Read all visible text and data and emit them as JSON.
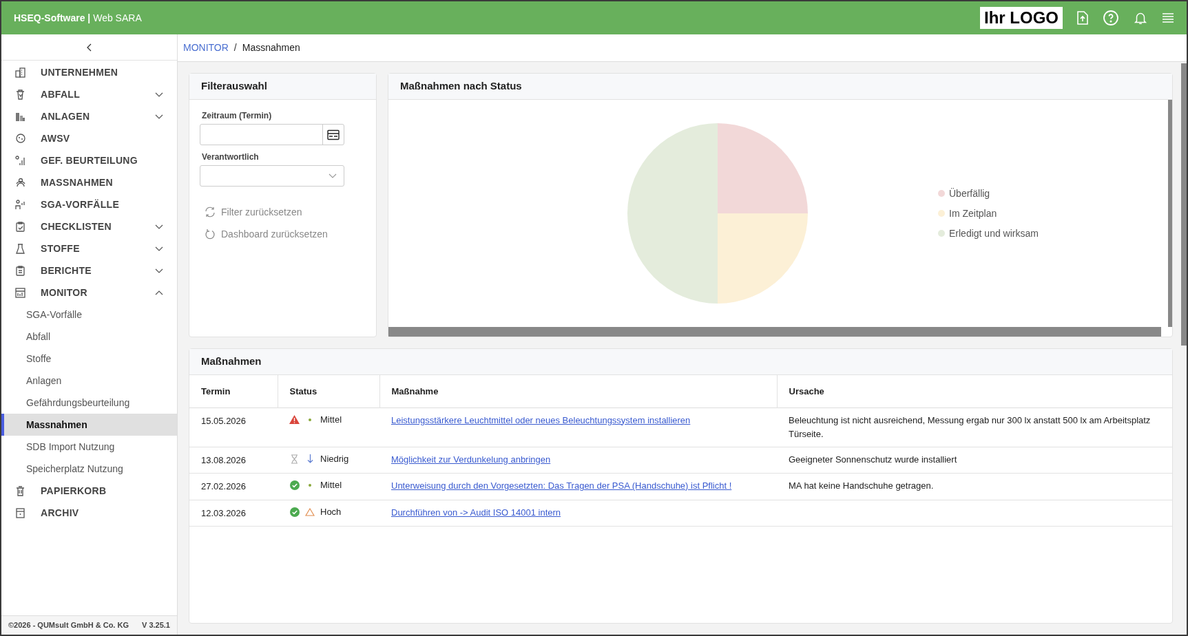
{
  "header": {
    "brand": "HSEQ-Software",
    "separator": "|",
    "product": "Web SARA",
    "logo": "Ihr LOGO"
  },
  "breadcrumb": {
    "separator": "/",
    "items": [
      {
        "label": "MONITOR",
        "link": true
      },
      {
        "label": "Massnahmen",
        "link": false
      }
    ]
  },
  "sidebar": {
    "items": [
      {
        "label": "UNTERNEHMEN",
        "expandable": false
      },
      {
        "label": "ABFALL",
        "expandable": true,
        "expanded": false
      },
      {
        "label": "ANLAGEN",
        "expandable": true,
        "expanded": false
      },
      {
        "label": "AWSV",
        "expandable": false
      },
      {
        "label": "GEF. BEURTEILUNG",
        "expandable": false
      },
      {
        "label": "MASSNAHMEN",
        "expandable": false
      },
      {
        "label": "SGA-VORFÄLLE",
        "expandable": false
      },
      {
        "label": "CHECKLISTEN",
        "expandable": true,
        "expanded": false
      },
      {
        "label": "STOFFE",
        "expandable": true,
        "expanded": false
      },
      {
        "label": "BERICHTE",
        "expandable": true,
        "expanded": false
      },
      {
        "label": "MONITOR",
        "expandable": true,
        "expanded": true,
        "children": [
          {
            "label": "SGA-Vorfälle",
            "selected": false
          },
          {
            "label": "Abfall",
            "selected": false
          },
          {
            "label": "Stoffe",
            "selected": false
          },
          {
            "label": "Anlagen",
            "selected": false
          },
          {
            "label": "Gefährdungsbeurteilung",
            "selected": false
          },
          {
            "label": "Massnahmen",
            "selected": true
          },
          {
            "label": "SDB Import Nutzung",
            "selected": false
          },
          {
            "label": "Speicherplatz Nutzung",
            "selected": false
          }
        ]
      },
      {
        "label": "PAPIERKORB",
        "expandable": false
      },
      {
        "label": "ARCHIV",
        "expandable": false
      }
    ],
    "footer": "©2026 - QUMsult GmbH & Co. KG",
    "version": "V 3.25.1"
  },
  "filter": {
    "title": "Filterauswahl",
    "fields": [
      {
        "label": "Zeitraum (Termin)",
        "kind": "date"
      },
      {
        "label": "Verantwortlich",
        "kind": "select"
      }
    ],
    "actions": [
      {
        "label": "Filter zurücksetzen"
      },
      {
        "label": "Dashboard zurücksetzen"
      }
    ]
  },
  "chart_panel": {
    "title": "Maßnahmen nach Status",
    "chart_data": {
      "type": "pie",
      "categories": [
        "Überfällig",
        "Im Zeitplan",
        "Erledigt und wirksam"
      ],
      "values": [
        25,
        25,
        50
      ]
    }
  },
  "table": {
    "title": "Maßnahmen",
    "columns": [
      "Termin",
      "Status",
      "Maßnahme",
      "Ursache"
    ],
    "rows": [
      {
        "termin": "15.05.2026",
        "status": {
          "kind": "overdue"
        },
        "priority": {
          "kind": "medium",
          "label": "Mittel"
        },
        "massnahme": "Leistungsstärkere Leuchtmittel oder neues Beleuchtungssystem installieren",
        "ursache": "Beleuchtung ist nicht ausreichend, Messung ergab nur 300 lx anstatt 500 lx am Arbeitsplatz Türseite."
      },
      {
        "termin": "13.08.2026",
        "status": {
          "kind": "scheduled"
        },
        "priority": {
          "kind": "low",
          "label": "Niedrig"
        },
        "massnahme": "Möglichkeit zur Verdunkelung anbringen",
        "ursache": "Geeigneter Sonnenschutz wurde installiert"
      },
      {
        "termin": "27.02.2026",
        "status": {
          "kind": "done"
        },
        "priority": {
          "kind": "medium",
          "label": "Mittel"
        },
        "massnahme": "Unterweisung durch den Vorgesetzten: Das Tragen der PSA (Handschuhe) ist Pflicht !",
        "ursache": "MA hat keine Handschuhe getragen."
      },
      {
        "termin": "12.03.2026",
        "status": {
          "kind": "done"
        },
        "priority": {
          "kind": "high",
          "label": "Hoch"
        },
        "massnahme": "Durchführen von -> Audit ISO 14001 intern"
      }
    ]
  }
}
